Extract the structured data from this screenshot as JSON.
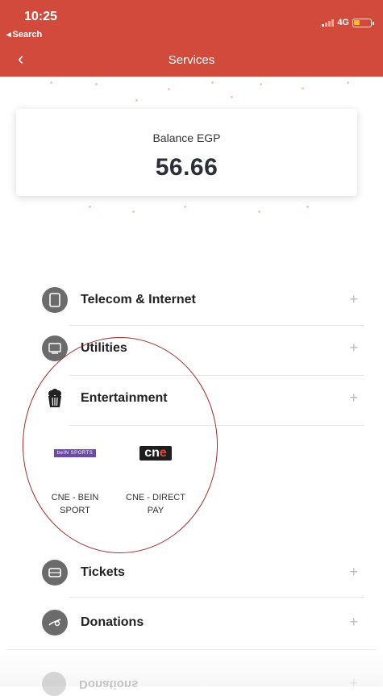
{
  "status_bar": {
    "time": "10:25",
    "back_label": "Search",
    "network": "4G",
    "battery_level": 0.35,
    "battery_color": "#f5c518"
  },
  "header": {
    "title": "Services",
    "back_icon": "chevron-left-icon",
    "color": "#d24a3c"
  },
  "balance": {
    "label": "Balance EGP",
    "value": "56.66"
  },
  "categories": [
    {
      "label": "Telecom & Internet",
      "icon": "phone-icon"
    },
    {
      "label": "Utilities",
      "icon": "utilities-icon"
    },
    {
      "label": "Entertainment",
      "icon": "popcorn-icon"
    },
    {
      "label": "Tickets",
      "icon": "ticket-icon"
    },
    {
      "label": "Donations",
      "icon": "donation-icon"
    }
  ],
  "entertainment_items": [
    {
      "name": "CNE - BEIN SPORT",
      "logo_text": "beIN SPORTS"
    },
    {
      "name": "CNE - DIRECT PAY",
      "logo_text": "cne"
    }
  ],
  "ghost_row": {
    "label": "Donations"
  },
  "plus_symbol": "+"
}
